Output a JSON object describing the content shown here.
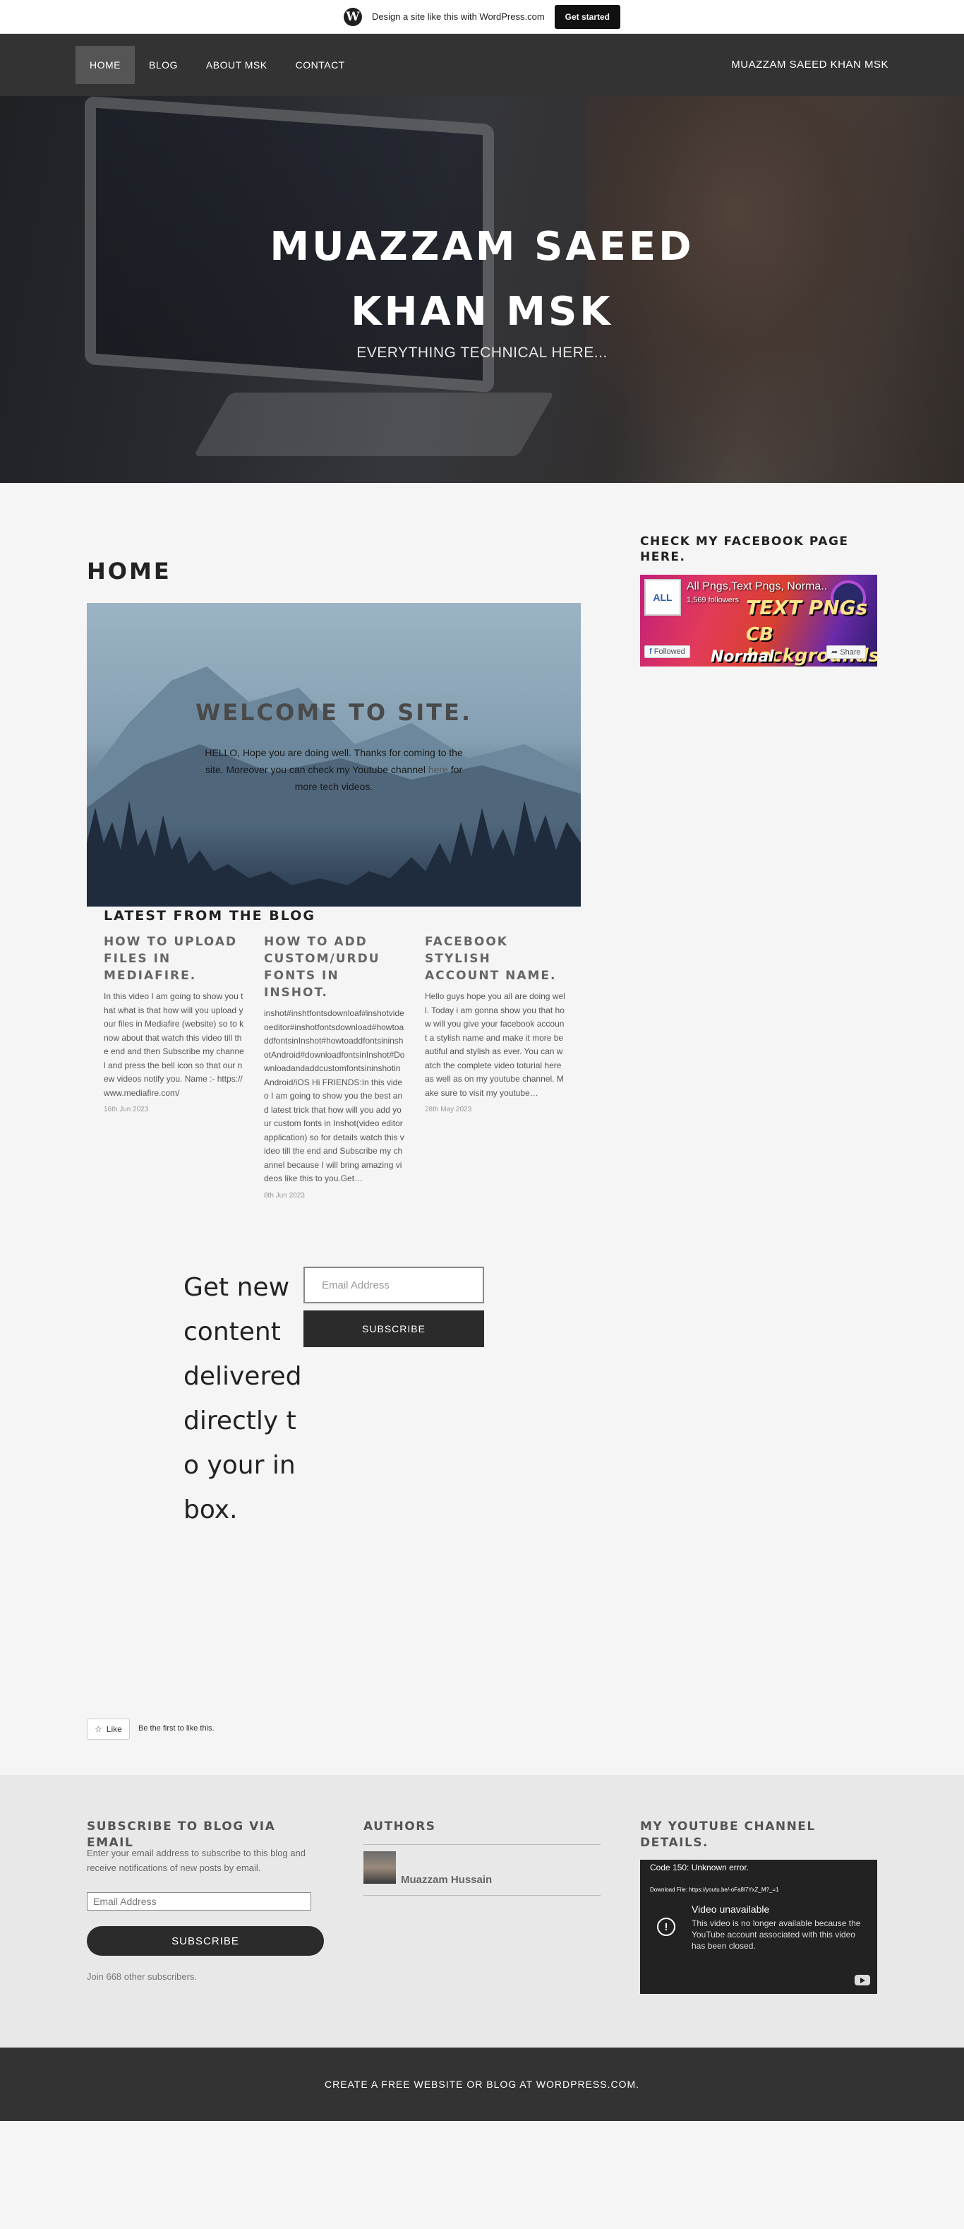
{
  "wp_banner": {
    "text": "Design a site like this with WordPress.com",
    "cta": "Get started"
  },
  "nav": {
    "items": [
      {
        "label": "HOME"
      },
      {
        "label": "BLOG"
      },
      {
        "label": "ABOUT MSK"
      },
      {
        "label": "CONTACT"
      }
    ],
    "site_name": "MUAZZAM SAEED KHAN MSK"
  },
  "hero": {
    "title_line1": "MUAZZAM SAEED",
    "title_line2": "KHAN MSK",
    "tagline": "EVERYTHING TECHNICAL HERE..."
  },
  "main": {
    "page_title": "HOME",
    "welcome": {
      "heading": "WELCOME TO SITE.",
      "text_before_link": "HELLO, Hope you are doing well. Thanks for coming to the site. Moreover you can check my Youtube channel",
      "link": "here",
      "text_after_link": " for more tech videos."
    },
    "latest_heading": "LATEST FROM THE BLOG",
    "posts": [
      {
        "title": "HOW TO UPLOAD FILES IN MEDIAFIRE.",
        "excerpt": "In this video I am going to show you that what is that how will you upload your files in Mediafire (website) so to know about that watch this video till the end and then Subscribe my channel and press the bell icon so that our new videos notify you. Name :- https://www.mediafire.com/",
        "date": "16th Jun 2023"
      },
      {
        "title": "HOW TO ADD CUSTOM/URDU FONTS IN INSHOT.",
        "excerpt": "inshot#inshtfontsdownloaf#inshotvideoeditor#inshotfontsdownload#howtoaddfontsinInshot#howtoaddfontsininshotAndroid#downloadfontsinInshot#DownloadandaddcustomfontsininshotinAndroid/iOS Hi FRIENDS:In this video I am going to show you the best and latest trick that how will you add your custom fonts in Inshot(video editor application) so for details watch this video till the end and Subscribe my channel because I will bring amazing videos like this to you.Get…",
        "date": "8th Jun 2023"
      },
      {
        "title": "FACEBOOK STYLISH ACCOUNT NAME.",
        "excerpt": "Hello guys hope you all are doing well. Today i am gonna show you that how will you give your facebook account a stylish name and make it more beautiful and stylish as ever. You can watch the complete video toturial here as well as on my youtube channel. Make sure to visit my youtube…",
        "date": "28th May 2023"
      }
    ],
    "subscribe": {
      "text": "Get new content delivered directly to your inbox.",
      "placeholder": "Email Address",
      "button": "SUBSCRIBE"
    },
    "like": {
      "button": "Like",
      "text": "Be the first to like this."
    }
  },
  "sidebar": {
    "facebook_heading": "CHECK MY FACEBOOK PAGE HERE.",
    "facebook": {
      "logo_text": "ALL",
      "page_name": "All Pngs,Text Pngs, Norma...",
      "followers": "1,569 followers",
      "image_text_1": "TEXT PNGs",
      "image_text_2": "CB backgrounds",
      "image_text_3": "Normal Backgrounds",
      "followed": "Followed",
      "share": "Share"
    }
  },
  "footer_widgets": {
    "subscribe": {
      "heading": "SUBSCRIBE TO BLOG VIA EMAIL",
      "text": "Enter your email address to subscribe to this blog and receive notifications of new posts by email.",
      "placeholder": "Email Address",
      "button": "SUBSCRIBE",
      "count": "Join 668 other subscribers."
    },
    "authors": {
      "heading": "AUTHORS",
      "name": "Muazzam Hussain"
    },
    "youtube": {
      "heading": "MY YOUTUBE CHANNEL DETAILS.",
      "error_code": "Code 150: Unknown error.",
      "download": "Download File: https://youtu.be/-oFa8l7YxZ_M?_=1",
      "title": "Video unavailable",
      "message": "This video is no longer available because the YouTube account associated with this video has been closed."
    }
  },
  "footer": {
    "text": "CREATE A FREE WEBSITE OR BLOG AT WORDPRESS.COM."
  },
  "colors": {
    "nav_bg": "#333333",
    "page_bg": "#f5f5f5",
    "footer_widgets_bg": "#e8e8e8",
    "button_dark": "#2b2b2b"
  }
}
